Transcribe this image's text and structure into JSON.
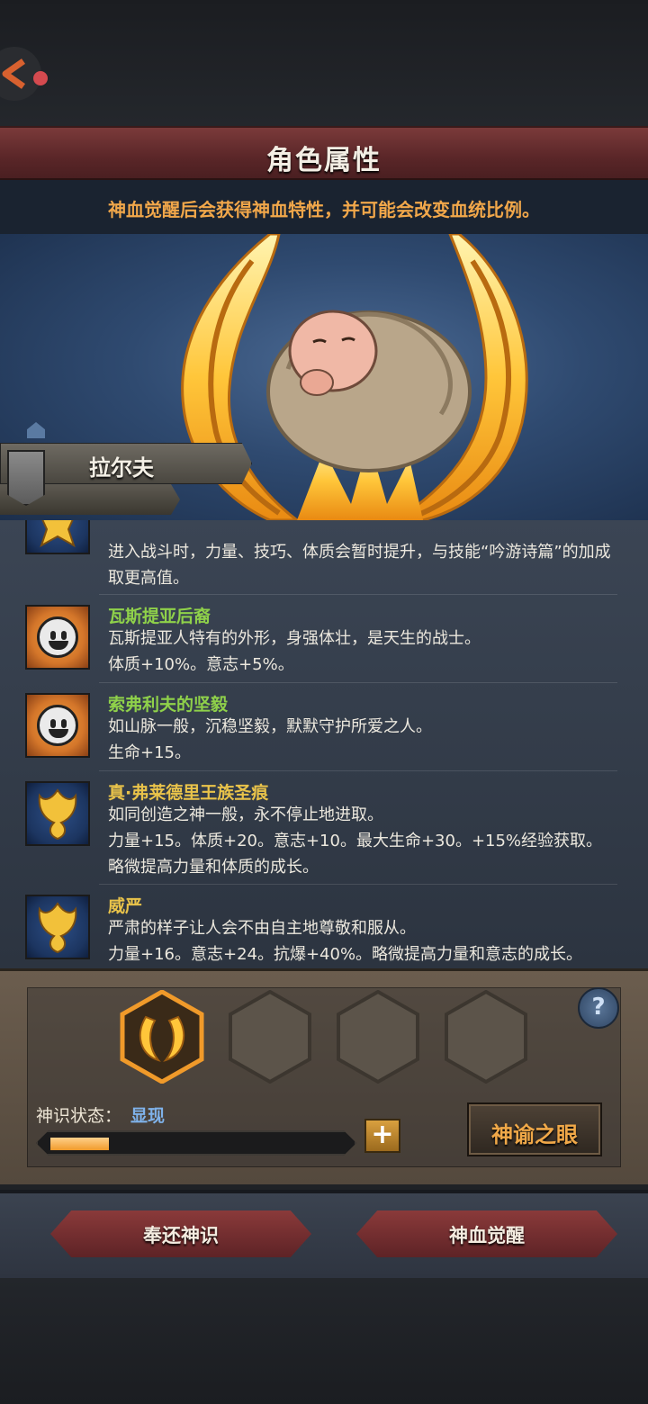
{
  "header": {
    "title": "角色属性",
    "subtitle": "神血觉醒后会获得神血特性，并可能会改变血统比例。"
  },
  "character": {
    "name": "拉尔夫"
  },
  "traits": [
    {
      "name": "",
      "name_color": "#e9c34a",
      "icon": "crest-icon",
      "desc": "进入战斗时，力量、技巧、体质会暂时提升，与技能“吟游诗篇”的加成取更高值。"
    },
    {
      "name": "瓦斯提亚后裔",
      "name_color": "#8fd14a",
      "icon": "smiley-sun-icon",
      "desc": "瓦斯提亚人特有的外形，身强体壮，是天生的战士。\n体质+10%。意志+5%。"
    },
    {
      "name": "索弗利夫的坚毅",
      "name_color": "#8fd14a",
      "icon": "smiley-sun-icon",
      "desc": "如山脉一般，沉稳坚毅，默默守护所爱之人。\n生命+15。"
    },
    {
      "name": "真·弗莱德里王族圣痕",
      "name_color": "#e9c34a",
      "icon": "crest-icon",
      "desc": "如同创造之神一般，永不停止地进取。\n力量+15。体质+20。意志+10。最大生命+30。+15%经验获取。略微提高力量和体质的成长。"
    },
    {
      "name": "威严",
      "name_color": "#e9c34a",
      "icon": "crest-icon",
      "desc": "严肃的样子让人会不由自主地尊敬和服从。\n力量+16。意志+24。抗爆+40%。略微提高力量和意志的成长。"
    }
  ],
  "awakening": {
    "status_label": "神识状态：",
    "status_value": "显现",
    "progress": 0.2,
    "plus_label": "+",
    "oracle_button": "神谕之眼",
    "help_label": "?"
  },
  "actions": {
    "return_button": "奉还神识",
    "awaken_button": "神血觉醒"
  },
  "colors": {
    "accent_orange": "#f1a74a",
    "status_blue": "#7fb2ea",
    "banner_red": "#6a2e30"
  }
}
